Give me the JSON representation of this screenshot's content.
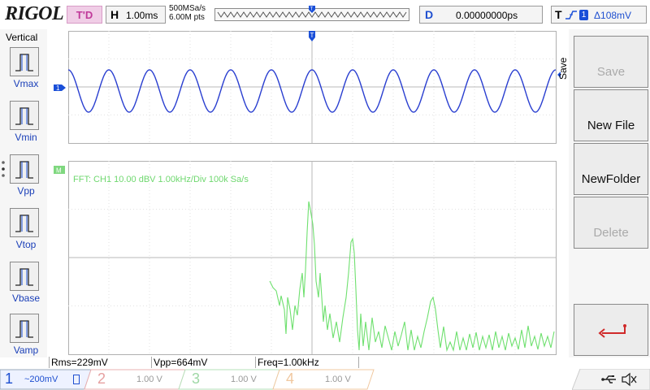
{
  "header": {
    "logo": "RIGOL",
    "run_state": "T'D",
    "horizontal_key": "H",
    "timebase": "1.00ms",
    "sample_rate": "500MSa/s",
    "memory_depth": "6.00M pts",
    "delay_key": "D",
    "delay_value": "0.00000000ps",
    "trigger_key": "T",
    "trigger_source": "1",
    "trigger_level": "Δ108mV"
  },
  "left_menu": {
    "title": "Vertical",
    "items": [
      {
        "label": "Vmax"
      },
      {
        "label": "Vmin"
      },
      {
        "label": "Vpp"
      },
      {
        "label": "Vtop"
      },
      {
        "label": "Vbase"
      },
      {
        "label": "Vamp"
      }
    ]
  },
  "waveform": {
    "channel_marker": "1",
    "math_marker": "M",
    "fft_info": "FFT:  CH1  10.00 dBV    1.00kHz/Div     100k Sa/s"
  },
  "right_menu": {
    "side_label": "Save",
    "buttons": [
      {
        "label": "Save",
        "enabled": false
      },
      {
        "label": "New File",
        "enabled": true
      },
      {
        "label": "NewFolder",
        "enabled": true
      },
      {
        "label": "Delete",
        "enabled": false
      },
      {
        "label": "",
        "icon": "return-arrow-icon"
      }
    ]
  },
  "measurements": {
    "rms": "Rms=229mV",
    "vpp": "Vpp=664mV",
    "freq": "Freq=1.00kHz"
  },
  "channels": [
    {
      "number": "1",
      "coupling_scale": "~200mV",
      "color": "#1e4fd0",
      "active": true
    },
    {
      "number": "2",
      "scale": "1.00 V",
      "color": "#e6a0a0",
      "active": false
    },
    {
      "number": "3",
      "scale": "1.00 V",
      "color": "#9fd8a6",
      "active": false
    },
    {
      "number": "4",
      "scale": "1.00 V",
      "color": "#f0c8a0",
      "active": false
    }
  ],
  "colors": {
    "ch1_trace": "#2a3fd0",
    "fft_trace": "#6fe06f",
    "grid": "#c8c8c8",
    "accent_blue": "#1a4fd8"
  }
}
